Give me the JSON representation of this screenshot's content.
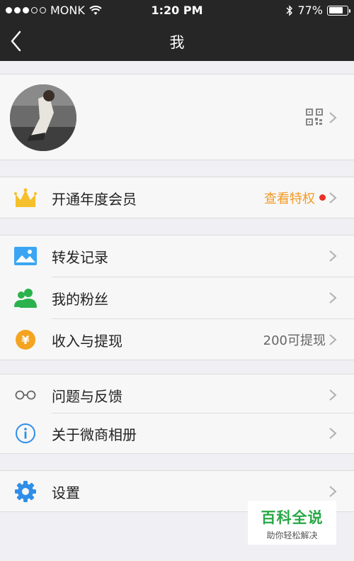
{
  "status_bar": {
    "carrier": "MONK",
    "time": "1:20 PM",
    "battery": "77%",
    "battery_level": 0.77,
    "icons": [
      "signal-dots-icon",
      "wifi-icon",
      "bluetooth-icon",
      "battery-icon"
    ]
  },
  "nav": {
    "title": "我",
    "back_icon": "chevron-left-icon"
  },
  "profile": {
    "qr_icon": "qr-code-icon"
  },
  "membership": {
    "label": "开通年度会员",
    "value": "查看特权",
    "icon": "crown-icon",
    "accent": "#f29b25",
    "badge_color": "#e8322a"
  },
  "menu_group_1": {
    "items": [
      {
        "label": "转发记录",
        "value": "",
        "icon": "image-icon"
      },
      {
        "label": "我的粉丝",
        "value": "",
        "icon": "users-icon"
      },
      {
        "label": "收入与提现",
        "value": "200可提现",
        "icon": "yen-coin-icon"
      }
    ]
  },
  "menu_group_2": {
    "items": [
      {
        "label": "问题与反馈",
        "value": "",
        "icon": "glasses-icon"
      },
      {
        "label": "关于微商相册",
        "value": "",
        "icon": "info-icon"
      }
    ]
  },
  "menu_group_3": {
    "items": [
      {
        "label": "设置",
        "value": "",
        "icon": "gear-icon"
      }
    ]
  },
  "watermark": {
    "title": "百科全说",
    "subtitle": "助你轻松解决"
  }
}
